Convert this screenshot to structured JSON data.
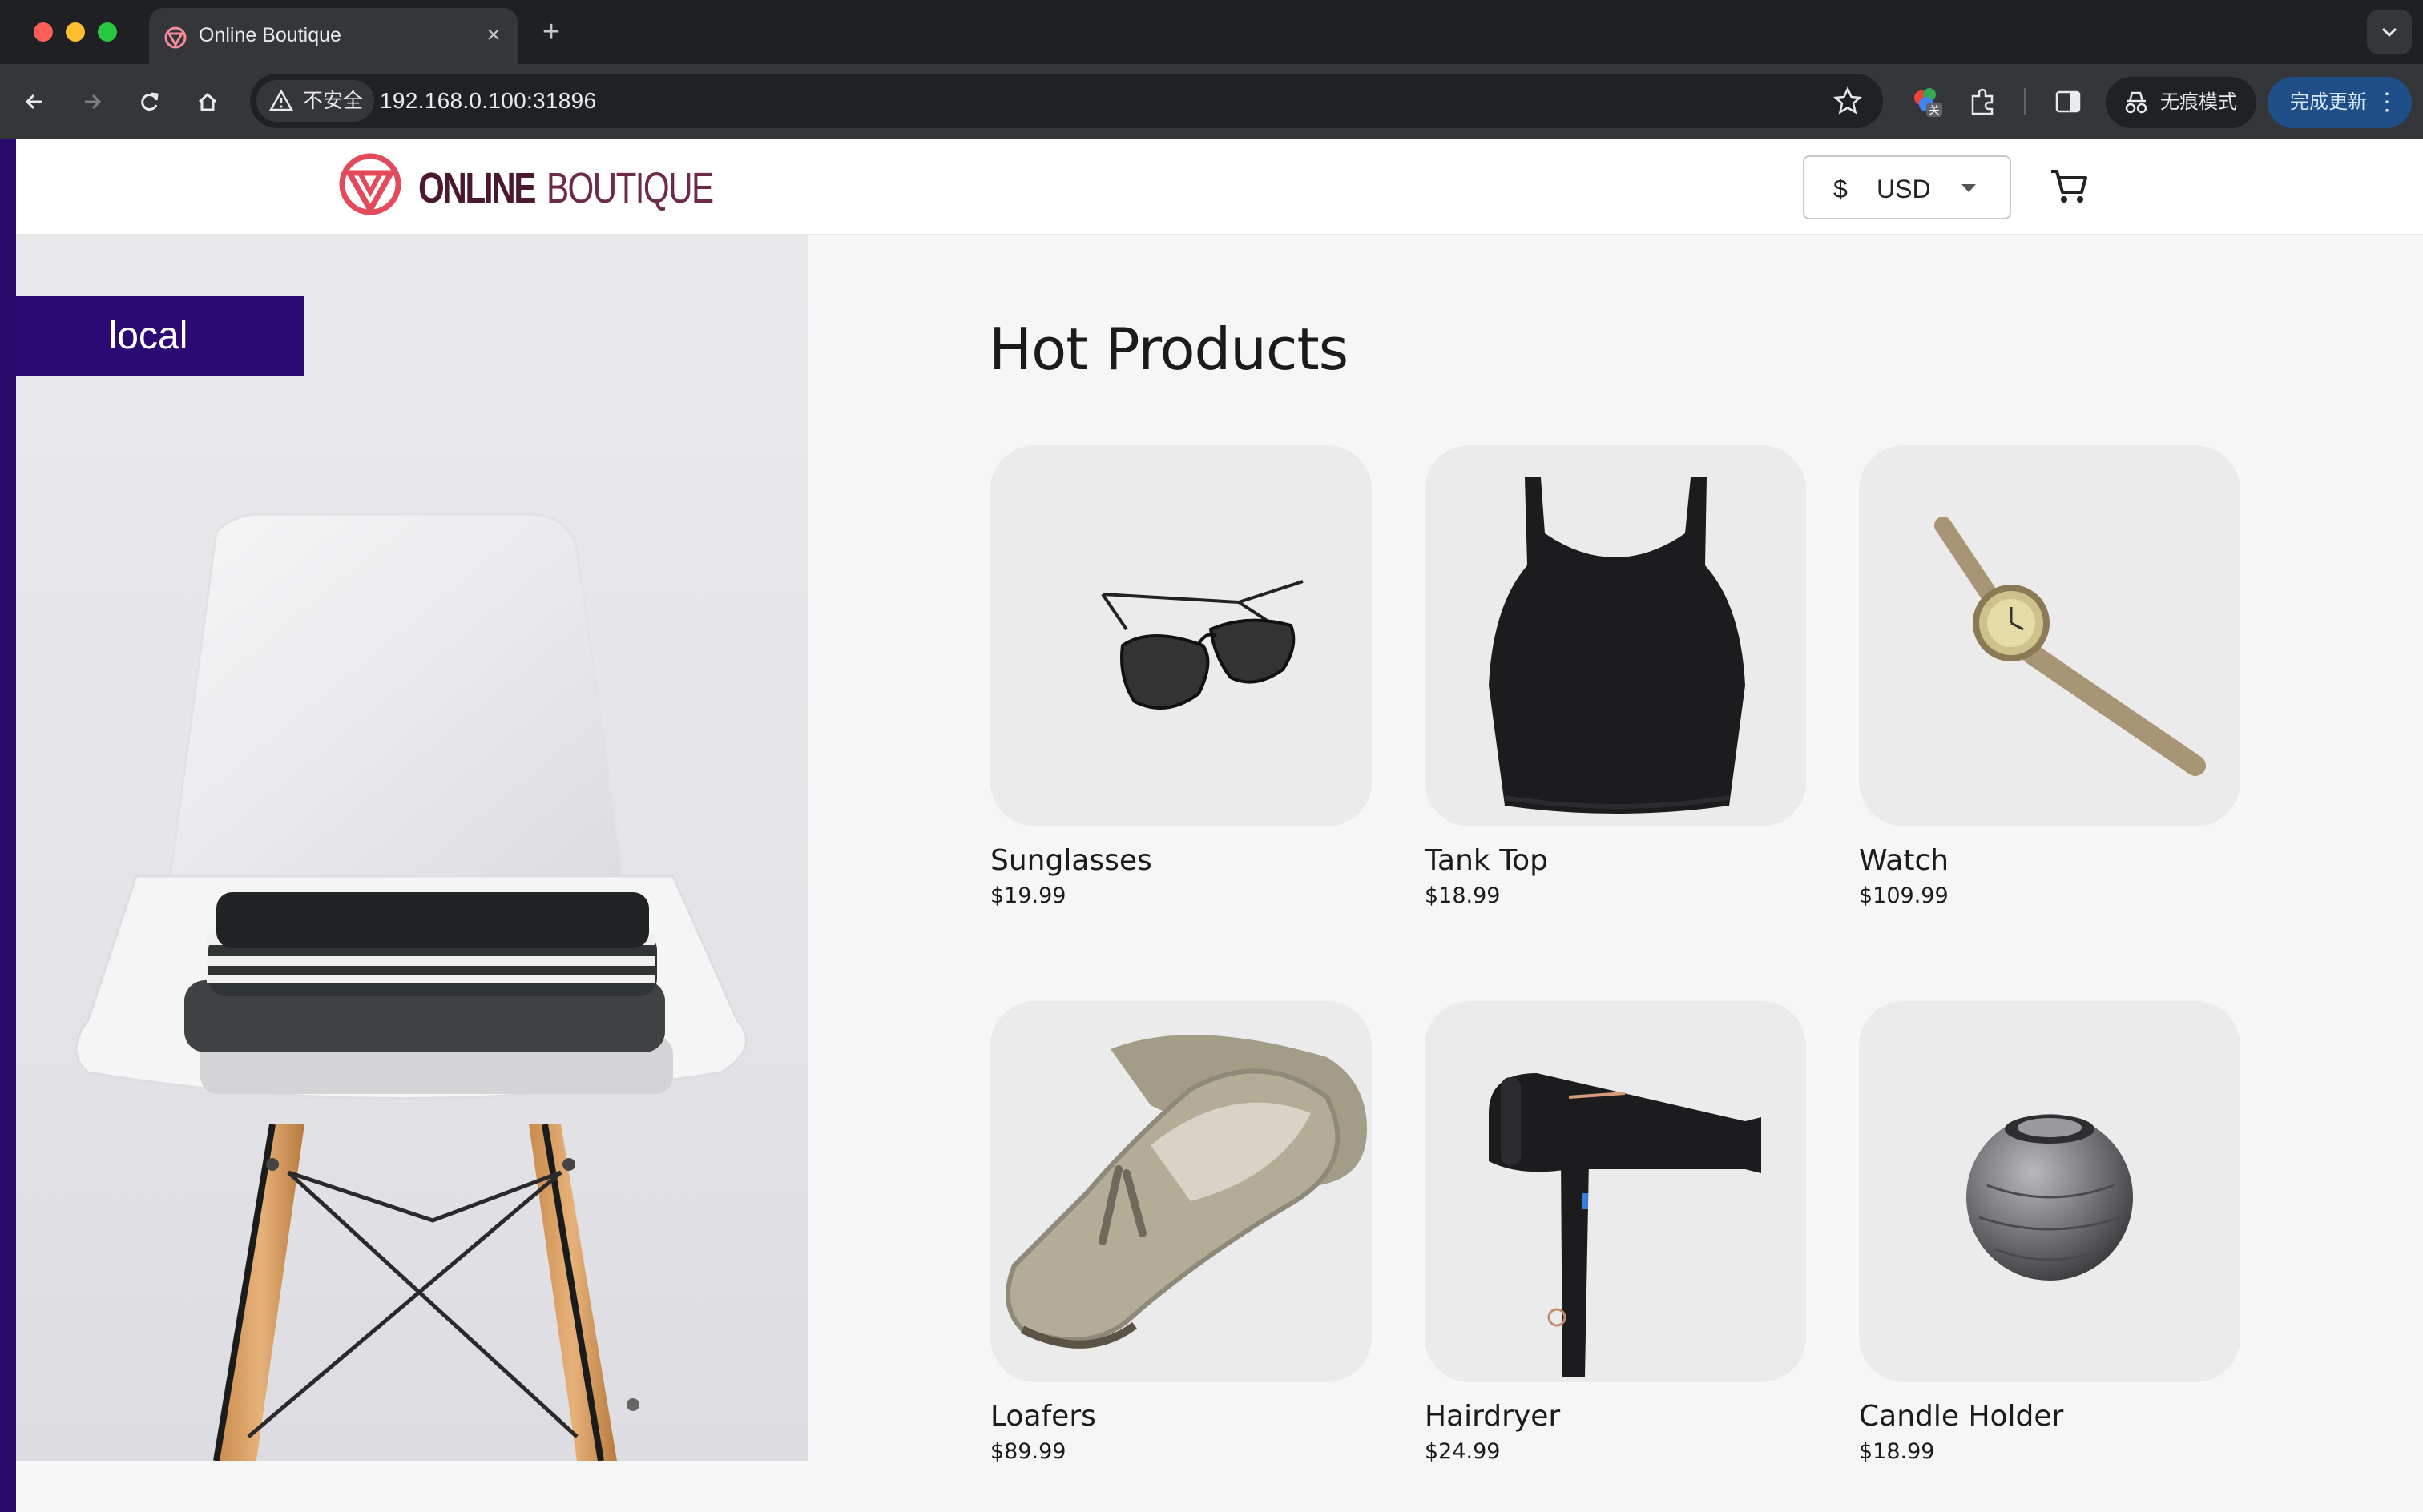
{
  "browser": {
    "tab_title": "Online Boutique",
    "security_label": "不安全",
    "url": "192.168.0.100:31896",
    "incognito_label": "无痕模式",
    "update_label": "完成更新",
    "extension_badge": "关"
  },
  "site": {
    "logo_online": "ONLINE",
    "logo_boutique": "BOUTIQUE",
    "currency_symbol": "$",
    "currency_code": "USD",
    "env_badge": "local",
    "section_title": "Hot Products",
    "accent_color": "#2b0a74",
    "logo_color": "#e34a5b"
  },
  "products": [
    {
      "name": "Sunglasses",
      "price": "$19.99",
      "icon": "sunglasses-image"
    },
    {
      "name": "Tank Top",
      "price": "$18.99",
      "icon": "tank-top-image"
    },
    {
      "name": "Watch",
      "price": "$109.99",
      "icon": "watch-image"
    },
    {
      "name": "Loafers",
      "price": "$89.99",
      "icon": "loafers-image"
    },
    {
      "name": "Hairdryer",
      "price": "$24.99",
      "icon": "hairdryer-image"
    },
    {
      "name": "Candle Holder",
      "price": "$18.99",
      "icon": "candle-holder-image"
    }
  ]
}
